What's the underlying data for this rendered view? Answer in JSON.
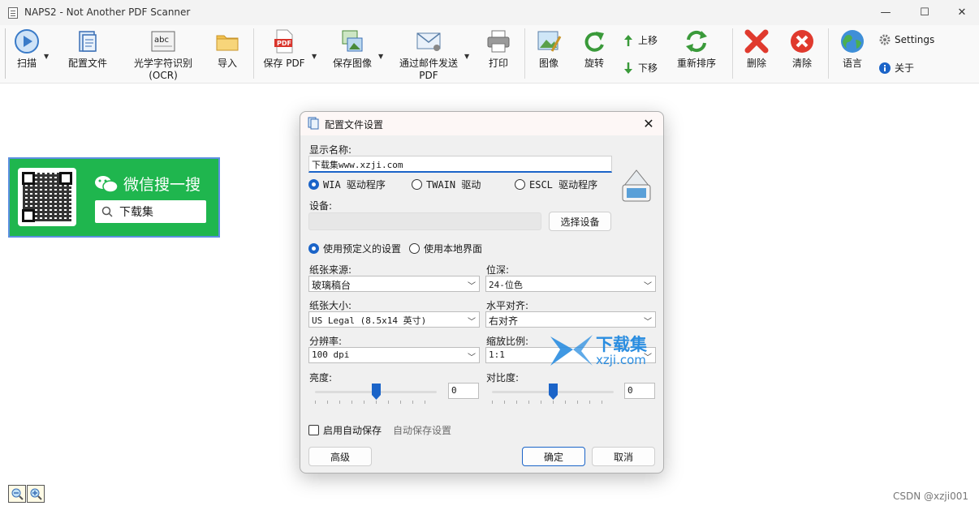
{
  "window": {
    "title": "NAPS2 - Not Another PDF Scanner",
    "minimize": "—",
    "maximize": "☐",
    "close": "✕"
  },
  "toolbar": {
    "scan": "扫描",
    "profiles": "配置文件",
    "ocr_line1": "光学字符识别",
    "ocr_line2": "(OCR)",
    "import": "导入",
    "save_pdf": "保存 PDF",
    "save_images": "保存图像",
    "email_line1": "通过邮件发送",
    "email_line2": "PDF",
    "print": "打印",
    "image": "图像",
    "rotate": "旋转",
    "move_up": "上移",
    "move_down": "下移",
    "reorder": "重新排序",
    "delete": "删除",
    "clear": "清除",
    "language": "语言",
    "settings": "Settings",
    "about": "关于"
  },
  "ad": {
    "wechat_text": "微信搜一搜",
    "search_text": "下载集"
  },
  "footer": {
    "csdn": "CSDN @xzji001"
  },
  "dialog": {
    "title": "配置文件设置",
    "close": "✕",
    "display_name_label": "显示名称:",
    "display_name_value": "下载集www.xzji.com",
    "drivers": [
      {
        "label": "WIA 驱动程序",
        "selected": true
      },
      {
        "label": "TWAIN 驱动",
        "selected": false
      },
      {
        "label": "ESCL 驱动程序",
        "selected": false
      }
    ],
    "device_label": "设备:",
    "device_value": "",
    "choose_device": "选择设备",
    "mode_predefined": "使用预定义的设置",
    "mode_native": "使用本地界面",
    "paper_source_label": "纸张来源:",
    "paper_source_value": "玻璃稿台",
    "bit_depth_label": "位深:",
    "bit_depth_value": "24-位色",
    "page_size_label": "纸张大小:",
    "page_size_value": "US Legal (8.5x14 英寸)",
    "h_align_label": "水平对齐:",
    "h_align_value": "右对齐",
    "resolution_label": "分辨率:",
    "resolution_value": "100 dpi",
    "scale_label": "缩放比例:",
    "scale_value": "1:1",
    "brightness_label": "亮度:",
    "brightness_value": "0",
    "brightness_level": 0.5,
    "contrast_label": "对比度:",
    "contrast_value": "0",
    "contrast_level": 0.5,
    "autosave_label": "启用自动保存",
    "autosave_settings": "自动保存设置",
    "advanced": "高级",
    "ok": "确定",
    "cancel": "取消"
  },
  "watermark": {
    "text_cn": "下载集",
    "text_url": "xzji.com"
  },
  "colors": {
    "accent": "#1b64c8",
    "ad_green": "#1fb64e",
    "delete_red": "#e03a2e"
  }
}
